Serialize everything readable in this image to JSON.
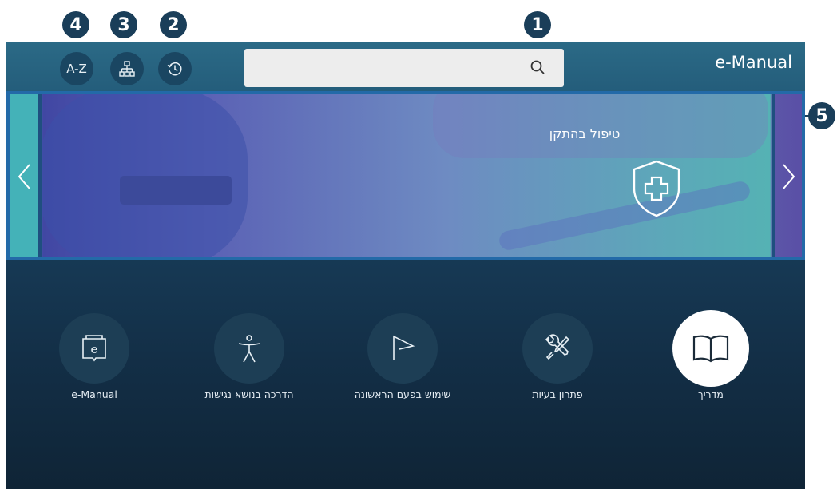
{
  "callouts": {
    "m1": "1",
    "m2": "2",
    "m3": "3",
    "m4": "4",
    "m5": "5"
  },
  "topbar": {
    "az_label": "A-Z",
    "sitemap_icon": "sitemap-icon",
    "history_icon": "history-icon",
    "search_icon": "search-icon",
    "search_value": "",
    "title": "e-Manual"
  },
  "banner": {
    "title": "טיפול בהתקן",
    "icon": "shield-plus-icon",
    "prev_icon": "chevron-left-icon",
    "next_icon": "chevron-right-icon"
  },
  "tiles": [
    {
      "label": "מדריך",
      "icon": "book-icon",
      "active": true
    },
    {
      "label": "פתרון בעיות",
      "icon": "wrench-screwdriver-icon",
      "active": false
    },
    {
      "label": "שימוש בפעם הראשונה",
      "icon": "flag-icon",
      "active": false
    },
    {
      "label": "הדרכה בנושא נגישות",
      "icon": "accessibility-icon",
      "active": false
    },
    {
      "label": "e-Manual",
      "icon": "emanual-book-icon",
      "active": false
    }
  ],
  "colors": {
    "accent": "#236aa8",
    "marker": "#1a3e59",
    "topbar": "#2b6a86",
    "background": "#173b57"
  }
}
